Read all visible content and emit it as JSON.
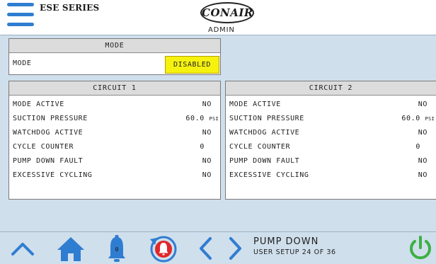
{
  "header": {
    "series_label": "ESE SERIES",
    "logo_text": "CONAIR",
    "user_role": "ADMIN"
  },
  "mode_panel": {
    "title": "MODE",
    "label": "MODE",
    "value": "DISABLED",
    "value_color": "#f5f20f"
  },
  "circuits": [
    {
      "title": "CIRCUIT 1",
      "rows": [
        {
          "label": "MODE ACTIVE",
          "value": "NO",
          "unit": ""
        },
        {
          "label": "SUCTION PRESSURE",
          "value": "60.0",
          "unit": "PSI"
        },
        {
          "label": "WATCHDOG ACTIVE",
          "value": "NO",
          "unit": ""
        },
        {
          "label": "CYCLE COUNTER",
          "value": "0",
          "unit": ""
        },
        {
          "label": "PUMP DOWN FAULT",
          "value": "NO",
          "unit": ""
        },
        {
          "label": "EXCESSIVE CYCLING",
          "value": "NO",
          "unit": ""
        }
      ]
    },
    {
      "title": "CIRCUIT 2",
      "rows": [
        {
          "label": "MODE ACTIVE",
          "value": "NO",
          "unit": ""
        },
        {
          "label": "SUCTION PRESSURE",
          "value": "60.0",
          "unit": "PSI"
        },
        {
          "label": "WATCHDOG ACTIVE",
          "value": "NO",
          "unit": ""
        },
        {
          "label": "CYCLE COUNTER",
          "value": "0",
          "unit": ""
        },
        {
          "label": "PUMP DOWN FAULT",
          "value": "NO",
          "unit": ""
        },
        {
          "label": "EXCESSIVE CYCLING",
          "value": "NO",
          "unit": ""
        }
      ]
    }
  ],
  "footer": {
    "title": "PUMP DOWN",
    "subtitle": "USER SETUP 24 OF 36",
    "alarm_count": "0",
    "icons": [
      "chevron-up-icon",
      "home-icon",
      "bell-icon",
      "alarm-history-icon",
      "chevron-left-icon",
      "chevron-right-icon",
      "power-icon"
    ],
    "colors": {
      "primary": "#2f7dd1",
      "alarm": "#e0262a",
      "power": "#3cb043"
    }
  }
}
